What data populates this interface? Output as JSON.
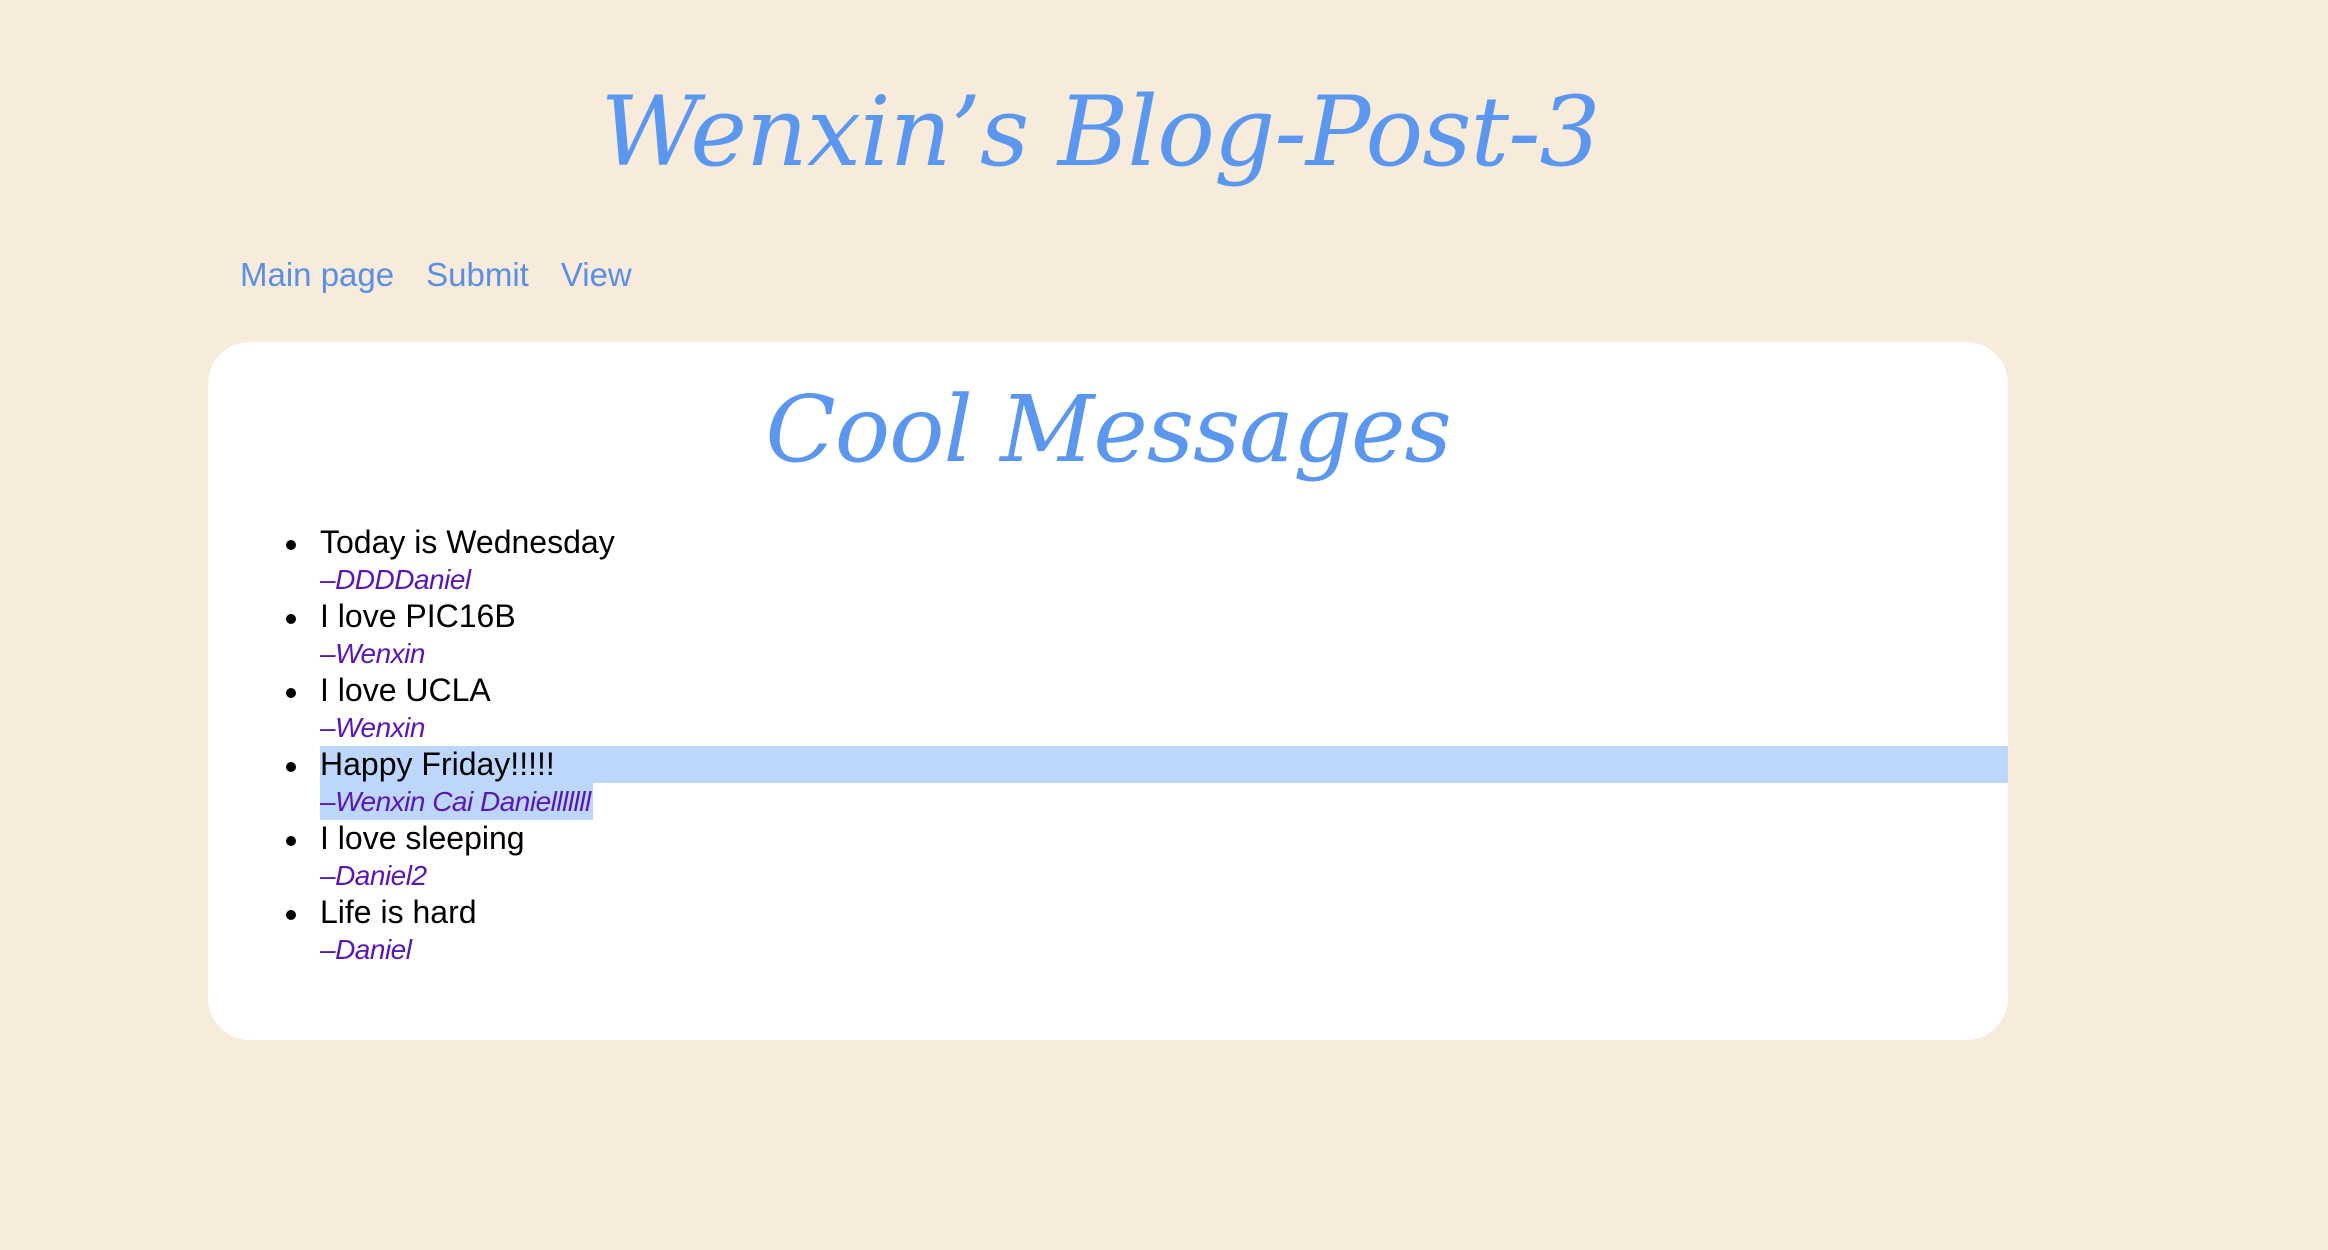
{
  "site": {
    "title": "Wenxin’s Blog-Post-3"
  },
  "nav": {
    "items": [
      "Main page",
      "Submit",
      "View"
    ]
  },
  "card": {
    "title": "Cool Messages",
    "messages": [
      {
        "text": "Today is Wednesday",
        "author": "–DDDDaniel"
      },
      {
        "text": "I love PIC16B",
        "author": "–Wenxin"
      },
      {
        "text": "I love UCLA",
        "author": "–Wenxin"
      },
      {
        "text": "Happy Friday!!!!!",
        "author": "–Wenxin Cai Danielllllll",
        "selected": true
      },
      {
        "text": "I love sleeping",
        "author": "–Daniel2"
      },
      {
        "text": "Life is hard",
        "author": "–Daniel"
      }
    ]
  },
  "colors": {
    "background": "#f7ebdb",
    "heading": "#5b97ee",
    "link": "#5b8fe6",
    "author": "#5b16b7",
    "selection": "#bcd7fb"
  }
}
